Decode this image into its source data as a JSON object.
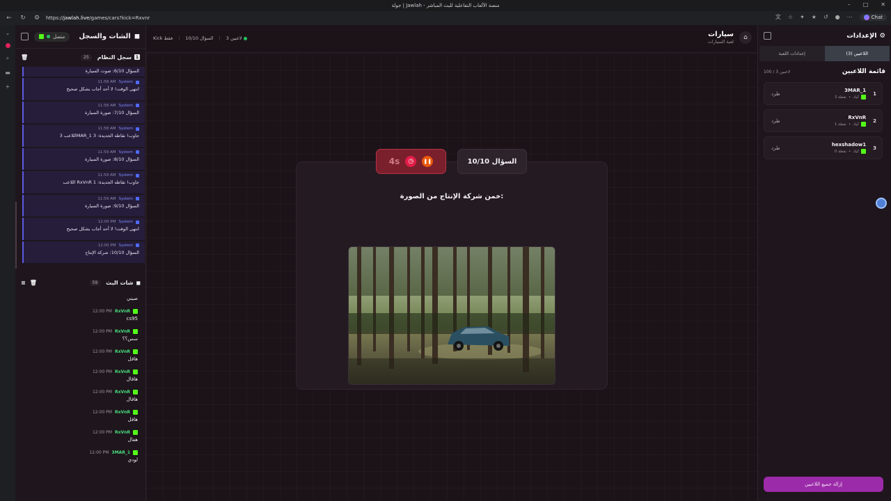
{
  "browser": {
    "title": "جولة | Jawlah - منصة الألعاب التفاعلية للبث المباشر",
    "url_prefix": "https://",
    "url_host": "jawlah.live",
    "url_path": "/games/cars?kick=Rxvnr",
    "chat_label": "Chat"
  },
  "chat_panel": {
    "title": "الشات والسجل",
    "status": "متصل",
    "syslog": {
      "title": "سجل النظام",
      "count": "25",
      "first": "السؤال 6/10: صوت السيارة",
      "items": [
        {
          "sender": "System",
          "time": "11:58 AM",
          "text": "انتهى الوقت! لا أحد أجاب بشكل صحيح"
        },
        {
          "sender": "System",
          "time": "11:58 AM",
          "text": "السؤال 7/10: صورة السيارة"
        },
        {
          "sender": "System",
          "time": "11:58 AM",
          "text": "اللاعب 3MAR_1 جاوب! نقاطه الجديدة: 3"
        },
        {
          "sender": "System",
          "time": "11:59 AM",
          "text": "السؤال 8/10: صورة السيارة"
        },
        {
          "sender": "System",
          "time": "11:59 AM",
          "text": "اللاعب RxVnR جاوب! نقاطه الجديدة: 1"
        },
        {
          "sender": "System",
          "time": "11:59 AM",
          "text": "السؤال 9/10: صورة السيارة"
        },
        {
          "sender": "System",
          "time": "12:00 PM",
          "text": "انتهى الوقت! لا أحد أجاب بشكل صحيح"
        },
        {
          "sender": "System",
          "time": "12:00 PM",
          "text": "السؤال 10/10: شركة الإنتاج"
        }
      ]
    },
    "stream_chat": {
      "title": "شات البث",
      "count": "59",
      "first": "صيني",
      "messages": [
        {
          "user": "RxVnR",
          "time": "12:00 PM",
          "text": "cs95"
        },
        {
          "user": "RxVnR",
          "time": "12:00 PM",
          "text": "سس؟؟"
        },
        {
          "user": "RxVnR",
          "time": "12:00 PM",
          "text": "هافل"
        },
        {
          "user": "RxVnR",
          "time": "12:00 PM",
          "text": "هافال"
        },
        {
          "user": "RxVnR",
          "time": "12:00 PM",
          "text": "هافال"
        },
        {
          "user": "RxVnR",
          "time": "12:00 PM",
          "text": "هافل"
        },
        {
          "user": "RxVnR",
          "time": "12:00 PM",
          "text": "هفال"
        },
        {
          "user": "3MAR_1",
          "time": "12:00 PM",
          "text": "لودي"
        }
      ]
    }
  },
  "mainbar": {
    "players": "3 لاعبين",
    "question": "السؤال 10/10",
    "mode": "Kick فقط",
    "game_title": "سيارات",
    "game_subtitle": "لعبة السيارات"
  },
  "question": {
    "label": "السؤال 10/10",
    "timer": "4s",
    "text": "خمن شركة الإنتاج من الصورة:"
  },
  "settings": {
    "title": "الإعدادات",
    "tabs": [
      "إعدادات اللعبة",
      "اللاعبين (3)"
    ],
    "players_title": "قائمة اللاعبين",
    "players_count": "100 / 3 لاعبين",
    "kick_label": "طرد",
    "players": [
      {
        "rank": "1",
        "name": "3MAR_1",
        "points": "3 نقطة",
        "platform": "كيك"
      },
      {
        "rank": "2",
        "name": "RxVnR",
        "points": "1 نقطة",
        "platform": "كيك"
      },
      {
        "rank": "3",
        "name": "hexshadow1",
        "points": "0 نقطة",
        "platform": "كيك"
      }
    ],
    "remove_all": "إزالة جميع اللاعبين"
  }
}
